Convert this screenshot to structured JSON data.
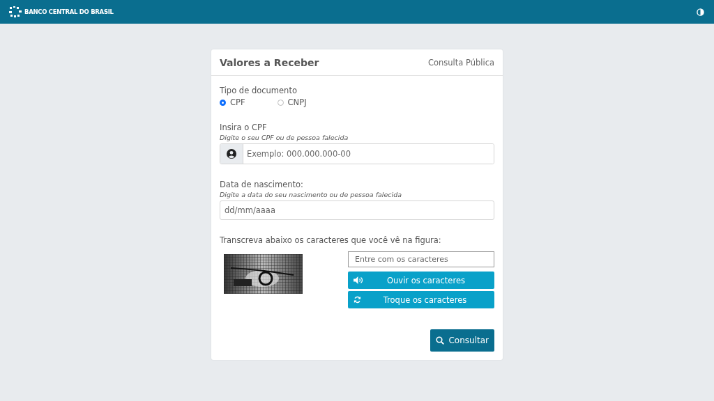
{
  "header": {
    "brand": "BANCO CENTRAL DO BRASIL"
  },
  "card": {
    "title": "Valores a Receber",
    "subtitle": "Consulta Pública"
  },
  "document_type": {
    "label": "Tipo de documento",
    "options": [
      {
        "label": "CPF",
        "selected": true
      },
      {
        "label": "CNPJ",
        "selected": false
      }
    ]
  },
  "cpf_field": {
    "label": "Insira o CPF",
    "hint": "Digite o seu CPF ou de pessoa falecida",
    "placeholder": "Exemplo: 000.000.000-00"
  },
  "birth_field": {
    "label": "Data de nascimento:",
    "hint": "Digite a data do seu nascimento ou de pessoa falecida",
    "placeholder": "dd/mm/aaaa"
  },
  "captcha": {
    "label": "Transcreva abaixo os caracteres que você vê na figura:",
    "placeholder": "Entre com os caracteres",
    "buttons": [
      {
        "kind": "audio",
        "label": "Ouvir os caracteres"
      },
      {
        "kind": "refresh",
        "label": "Troque os caracteres"
      }
    ]
  },
  "submit": {
    "label": "Consultar"
  }
}
